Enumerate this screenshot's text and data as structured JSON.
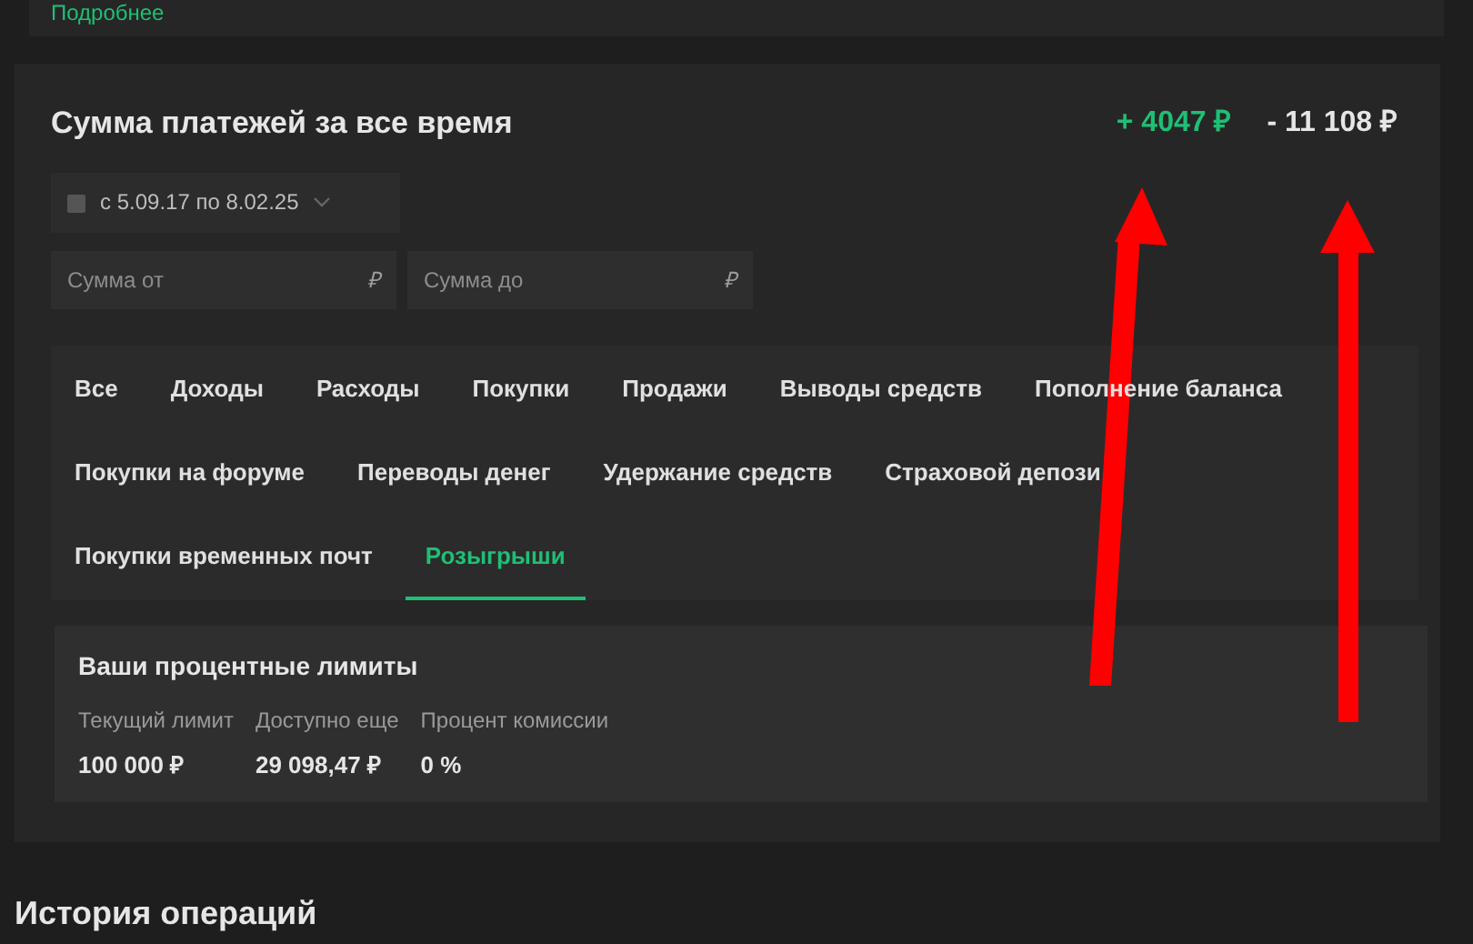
{
  "top_card": {
    "link": "Подробнее"
  },
  "summary": {
    "title": "Сумма платежей за все время",
    "income": "+ 4047 ₽",
    "expense": "- 11 108 ₽"
  },
  "filters": {
    "date_range": "с 5.09.17 по 8.02.25",
    "amount_from": {
      "placeholder": "Сумма от",
      "currency": "₽"
    },
    "amount_to": {
      "placeholder": "Сумма до",
      "currency": "₽"
    }
  },
  "tabs": [
    {
      "label": "Все",
      "selected": false
    },
    {
      "label": "Доходы",
      "selected": false
    },
    {
      "label": "Расходы",
      "selected": false
    },
    {
      "label": "Покупки",
      "selected": false
    },
    {
      "label": "Продажи",
      "selected": false
    },
    {
      "label": "Выводы средств",
      "selected": false
    },
    {
      "label": "Пополнение баланса",
      "selected": false
    },
    {
      "label": "Покупки на форуме",
      "selected": false
    },
    {
      "label": "Переводы денег",
      "selected": false
    },
    {
      "label": "Удержание средств",
      "selected": false
    },
    {
      "label": "Страховой депози",
      "selected": false
    },
    {
      "label": "Покупки временных почт",
      "selected": false
    },
    {
      "label": "Розыгрыши",
      "selected": true
    }
  ],
  "limits": {
    "title": "Ваши процентные лимиты",
    "items": [
      {
        "label": "Текущий лимит",
        "value": "100 000 ₽"
      },
      {
        "label": "Доступно еще",
        "value": "29 098,47 ₽"
      },
      {
        "label": "Процент комиссии",
        "value": "0 %"
      }
    ]
  },
  "history": {
    "title": "История операций"
  }
}
